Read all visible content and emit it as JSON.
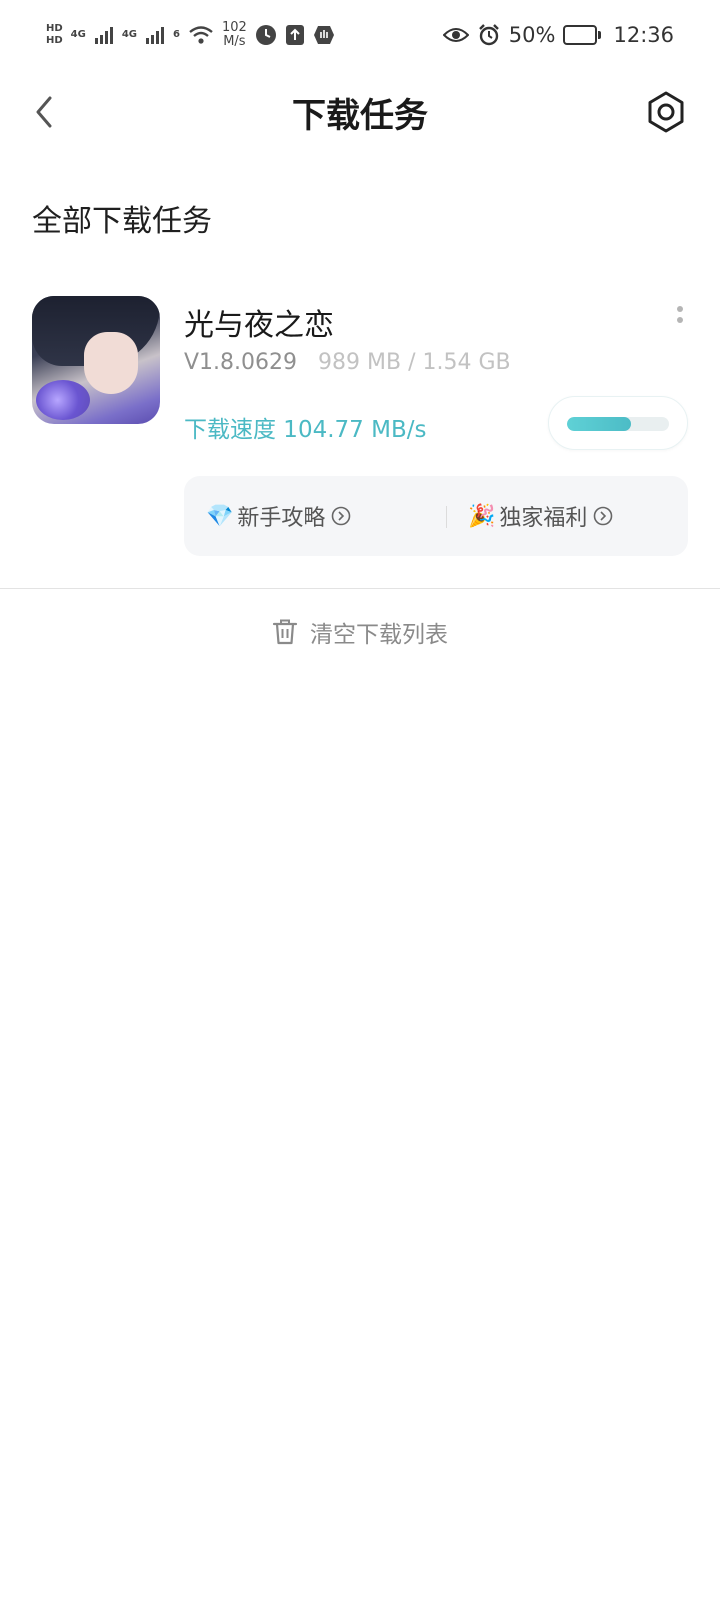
{
  "status_bar": {
    "hd_top": "HD",
    "hd_bottom": "HD",
    "net1": "4G",
    "net2": "4G",
    "wifi_label": "6",
    "speed_value": "102",
    "speed_unit": "M/s",
    "battery_percent": "50%",
    "battery_level": 0.5,
    "time": "12:36",
    "icons": [
      "signal-icon",
      "wifi-icon",
      "timer-icon",
      "upload-icon",
      "hand-icon",
      "eye-icon",
      "alarm-icon",
      "battery-icon"
    ]
  },
  "header": {
    "title": "下载任务"
  },
  "section": {
    "title": "全部下载任务"
  },
  "task": {
    "name": "光与夜之恋",
    "version": "V1.8.0629",
    "size": "989 MB / 1.54 GB",
    "speed": "下载速度 104.77 MB/s",
    "progress": 0.63,
    "accent_color": "#4bb9c4"
  },
  "links": {
    "guide_emoji": "💎",
    "guide_label": "新手攻略",
    "benefit_emoji": "🎉",
    "benefit_label": "独家福利"
  },
  "footer": {
    "clear_label": "清空下载列表"
  }
}
